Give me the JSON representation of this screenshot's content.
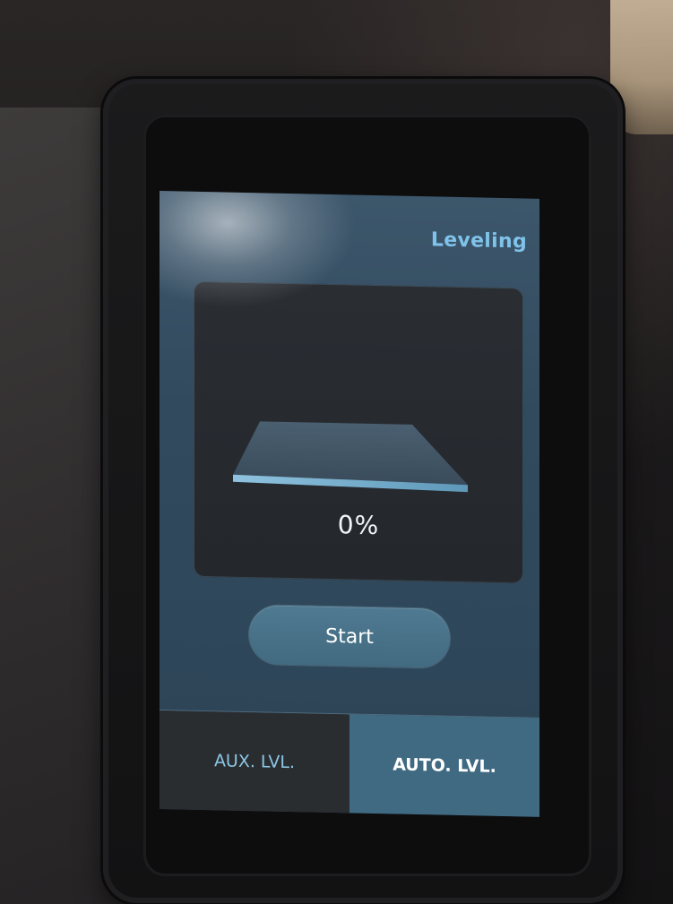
{
  "screen": {
    "title": "Leveling",
    "progress_text": "0%",
    "progress_value": 0,
    "start_label": "Start"
  },
  "tabs": [
    {
      "label": "AUX. LVL.",
      "selected": false
    },
    {
      "label": "AUTO. LVL.",
      "selected": true
    }
  ],
  "colors": {
    "accent_text": "#7fc2ea",
    "screen_background": "#324a5e",
    "selected_tab": "#3f6a82",
    "unselected_tab": "#2a2d30",
    "button": "#4f7a91"
  },
  "icons": {
    "preview": "print-bed-icon"
  }
}
